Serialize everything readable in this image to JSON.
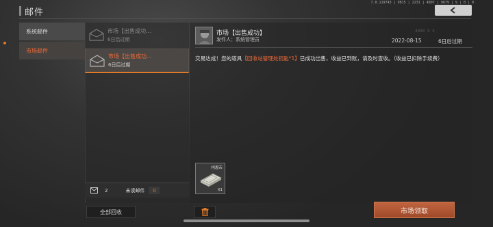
{
  "version": "7.0.119743 | 0815 | 2231 | 4807 | 9679 | 9 | 0 | 0",
  "header": {
    "title": "邮件"
  },
  "categories": [
    {
      "label": "系统邮件",
      "selected": false
    },
    {
      "label": "市场邮件",
      "selected": true
    }
  ],
  "mails": [
    {
      "title": "市场【出售成功...",
      "subtitle": "6日后过期",
      "selected": false
    },
    {
      "title": "市场【出售成功...",
      "subtitle": "6日后过期",
      "selected": true
    }
  ],
  "counter": {
    "count": "2",
    "unread_label": "未读邮件",
    "unread_count": "0"
  },
  "collect_all_label": "全部回收",
  "detail": {
    "title": "市场【出售成功】",
    "sender": "发件人：系统管理员",
    "faint_number": "4880 9 5",
    "date": "2022-08-15",
    "expire": "6日后过期",
    "body_before": "交易达成！您的道具",
    "body_highlight": "【回收站管理处钥匙*1】",
    "body_after": "已成功出售，收益已到账，请及时查收。（收益已扣除手续费）",
    "attachment": {
      "name": "柯恩币",
      "qty": "X1",
      "icon": "cash-stack-icon"
    }
  },
  "claim_label": "市场领取",
  "colors": {
    "accent": "#e07a28",
    "highlight_text": "#f06a38",
    "claim_button": "#b0573a"
  }
}
